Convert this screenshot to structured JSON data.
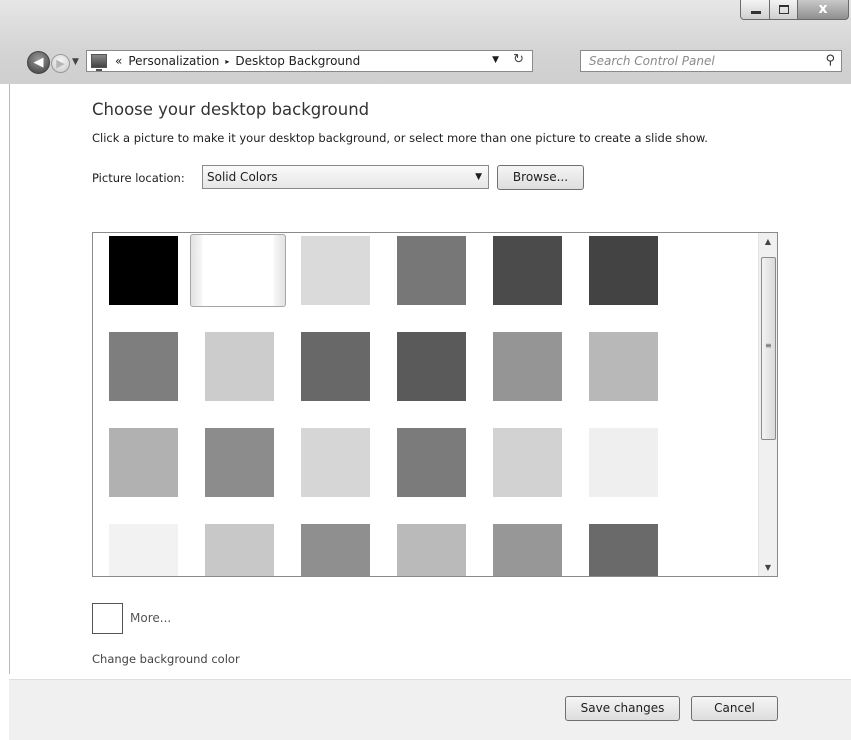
{
  "window": {
    "controls": {
      "minimize": "minimize",
      "maximize": "maximize",
      "close": "x"
    }
  },
  "nav": {
    "back_icon": "back-arrow-icon",
    "forward_icon": "forward-arrow-icon",
    "breadcrumb_overflow": "«",
    "breadcrumb": [
      "Personalization",
      "Desktop Background"
    ],
    "breadcrumb_separator": "▸",
    "refresh_icon": "refresh-icon",
    "search_placeholder": "Search Control Panel"
  },
  "main": {
    "title": "Choose your desktop background",
    "subtitle": "Click a picture to make it your desktop background, or select more than one picture to create a slide show.",
    "location_label": "Picture location:",
    "location_value": "Solid Colors",
    "browse_label": "Browse...",
    "more_label": "More...",
    "change_color_label": "Change background color"
  },
  "swatches": [
    [
      "#000000",
      "#ffffff",
      "#dadada",
      "#777777",
      "#4b4b4b",
      "#434343"
    ],
    [
      "#7e7e7e",
      "#cccccc",
      "#686868",
      "#5a5a5a",
      "#959595",
      "#b8b8b8"
    ],
    [
      "#b1b1b1",
      "#8c8c8c",
      "#d6d6d6",
      "#7b7b7b",
      "#d2d2d2",
      "#efefef"
    ],
    [
      "#f2f2f2",
      "#c8c8c8",
      "#8f8f8f",
      "#bababa",
      "#979797",
      "#6a6a6a"
    ]
  ],
  "footer": {
    "save_label": "Save changes",
    "cancel_label": "Cancel"
  }
}
